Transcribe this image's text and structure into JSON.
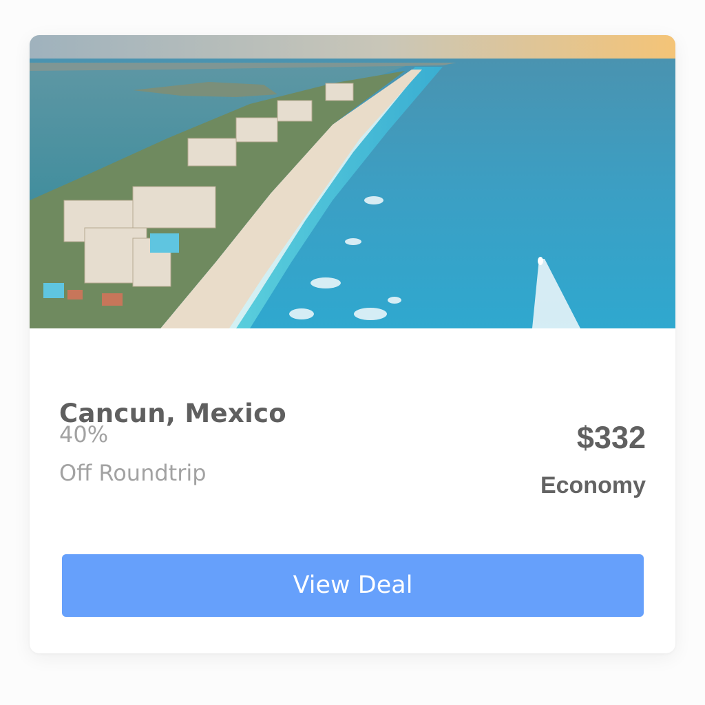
{
  "deal": {
    "image_alt": "Aerial view of Cancun hotel zone beach",
    "destination": "Cancun, Mexico",
    "discount_value": "40%",
    "discount_label": "Off Roundtrip",
    "price": "$332",
    "fare_class": "Economy",
    "cta_label": "View Deal"
  },
  "colors": {
    "button": "#66a0fb",
    "title": "#5f5f5f",
    "muted": "#a2a2a2"
  }
}
